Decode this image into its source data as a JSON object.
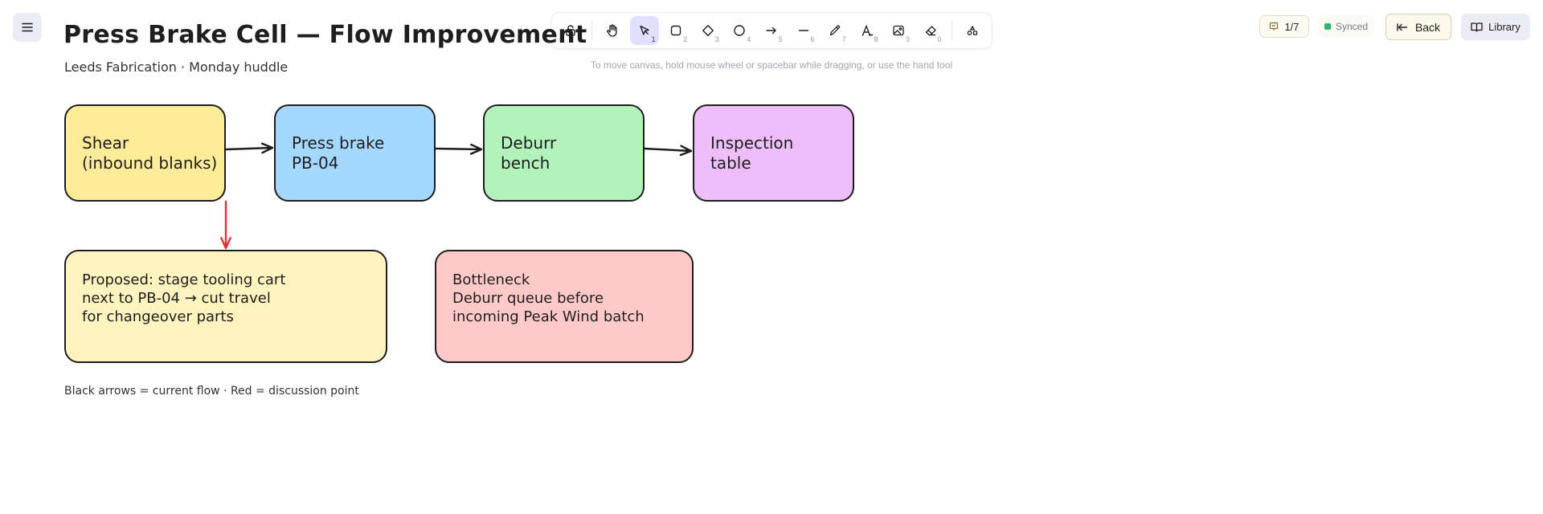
{
  "app": {
    "menu_icon": "hamburger-menu-icon",
    "hint": "To move canvas, hold mouse wheel or spacebar while dragging, or use the hand tool"
  },
  "toolbar": {
    "tools": [
      {
        "name": "lock-icon",
        "key": ""
      },
      {
        "name": "hand-icon",
        "key": ""
      },
      {
        "name": "selection-icon",
        "key": "1"
      },
      {
        "name": "rectangle-icon",
        "key": "2"
      },
      {
        "name": "diamond-icon",
        "key": "3"
      },
      {
        "name": "ellipse-icon",
        "key": "4"
      },
      {
        "name": "arrow-icon",
        "key": "5"
      },
      {
        "name": "line-icon",
        "key": "6"
      },
      {
        "name": "pencil-icon",
        "key": "7"
      },
      {
        "name": "text-icon",
        "key": "8"
      },
      {
        "name": "image-icon",
        "key": "9"
      },
      {
        "name": "eraser-icon",
        "key": "0"
      },
      {
        "name": "extra-tools-icon",
        "key": ""
      }
    ],
    "active_tool": "selection-icon"
  },
  "status": {
    "pager": "1/7",
    "synced": "Synced",
    "synced_color": "#2fb36a",
    "back": "Back",
    "library": "Library"
  },
  "canvas": {
    "title": "Press Brake Cell — Flow Improvement",
    "subtitle": "Leeds Fabrication · Monday huddle",
    "legend": "Black arrows = current flow · Red = discussion point",
    "boxes": {
      "shear": {
        "text": "Shear\n(inbound blanks)",
        "fill": "#ffec99"
      },
      "press": {
        "text": "Press brake\nPB-04",
        "fill": "#a5d8ff"
      },
      "deburr": {
        "text": "Deburr\nbench",
        "fill": "#b2f2bb"
      },
      "inspection": {
        "text": "Inspection\ntable",
        "fill": "#eebefa"
      },
      "proposed": {
        "text": "Proposed: stage tooling cart\nnext to PB-04 → cut travel\nfor changeover parts",
        "fill": "#fff3bf"
      },
      "bottleneck": {
        "text": "Bottleneck\nDeburr queue before\nincoming Peak Wind batch",
        "fill": "#ffc9c9"
      }
    },
    "arrow_colors": {
      "flow": "#1e1e1e",
      "discussion": "#e03131"
    }
  }
}
